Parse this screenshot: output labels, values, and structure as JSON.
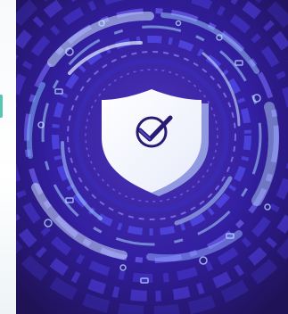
{
  "illustration": {
    "subject": "shield-checkmark-icon",
    "colors": {
      "background_dark": "#23165e",
      "background_mid": "#3a22a5",
      "accent_blue": "#5a57ff",
      "accent_light": "#bfe6ff",
      "shield_fill": "#ffffff",
      "check_stroke": "#2b1a73"
    }
  }
}
